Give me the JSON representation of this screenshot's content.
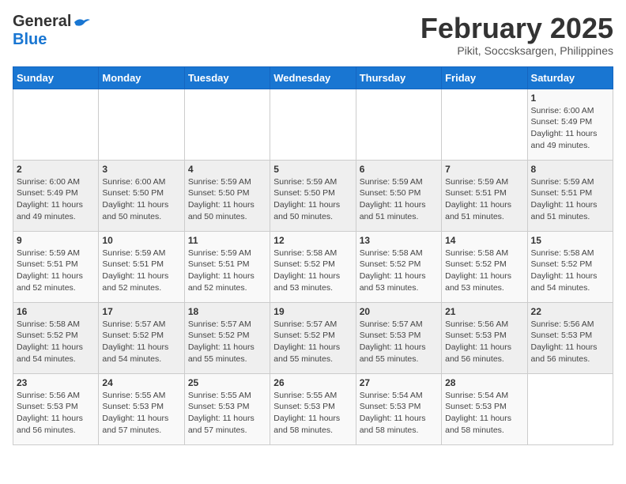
{
  "header": {
    "logo_general": "General",
    "logo_blue": "Blue",
    "month_title": "February 2025",
    "location": "Pikit, Soccsksargen, Philippines"
  },
  "calendar": {
    "days_of_week": [
      "Sunday",
      "Monday",
      "Tuesday",
      "Wednesday",
      "Thursday",
      "Friday",
      "Saturday"
    ],
    "weeks": [
      [
        {
          "day": "",
          "info": ""
        },
        {
          "day": "",
          "info": ""
        },
        {
          "day": "",
          "info": ""
        },
        {
          "day": "",
          "info": ""
        },
        {
          "day": "",
          "info": ""
        },
        {
          "day": "",
          "info": ""
        },
        {
          "day": "1",
          "info": "Sunrise: 6:00 AM\nSunset: 5:49 PM\nDaylight: 11 hours\nand 49 minutes."
        }
      ],
      [
        {
          "day": "2",
          "info": "Sunrise: 6:00 AM\nSunset: 5:49 PM\nDaylight: 11 hours\nand 49 minutes."
        },
        {
          "day": "3",
          "info": "Sunrise: 6:00 AM\nSunset: 5:50 PM\nDaylight: 11 hours\nand 50 minutes."
        },
        {
          "day": "4",
          "info": "Sunrise: 5:59 AM\nSunset: 5:50 PM\nDaylight: 11 hours\nand 50 minutes."
        },
        {
          "day": "5",
          "info": "Sunrise: 5:59 AM\nSunset: 5:50 PM\nDaylight: 11 hours\nand 50 minutes."
        },
        {
          "day": "6",
          "info": "Sunrise: 5:59 AM\nSunset: 5:50 PM\nDaylight: 11 hours\nand 51 minutes."
        },
        {
          "day": "7",
          "info": "Sunrise: 5:59 AM\nSunset: 5:51 PM\nDaylight: 11 hours\nand 51 minutes."
        },
        {
          "day": "8",
          "info": "Sunrise: 5:59 AM\nSunset: 5:51 PM\nDaylight: 11 hours\nand 51 minutes."
        }
      ],
      [
        {
          "day": "9",
          "info": "Sunrise: 5:59 AM\nSunset: 5:51 PM\nDaylight: 11 hours\nand 52 minutes."
        },
        {
          "day": "10",
          "info": "Sunrise: 5:59 AM\nSunset: 5:51 PM\nDaylight: 11 hours\nand 52 minutes."
        },
        {
          "day": "11",
          "info": "Sunrise: 5:59 AM\nSunset: 5:51 PM\nDaylight: 11 hours\nand 52 minutes."
        },
        {
          "day": "12",
          "info": "Sunrise: 5:58 AM\nSunset: 5:52 PM\nDaylight: 11 hours\nand 53 minutes."
        },
        {
          "day": "13",
          "info": "Sunrise: 5:58 AM\nSunset: 5:52 PM\nDaylight: 11 hours\nand 53 minutes."
        },
        {
          "day": "14",
          "info": "Sunrise: 5:58 AM\nSunset: 5:52 PM\nDaylight: 11 hours\nand 53 minutes."
        },
        {
          "day": "15",
          "info": "Sunrise: 5:58 AM\nSunset: 5:52 PM\nDaylight: 11 hours\nand 54 minutes."
        }
      ],
      [
        {
          "day": "16",
          "info": "Sunrise: 5:58 AM\nSunset: 5:52 PM\nDaylight: 11 hours\nand 54 minutes."
        },
        {
          "day": "17",
          "info": "Sunrise: 5:57 AM\nSunset: 5:52 PM\nDaylight: 11 hours\nand 54 minutes."
        },
        {
          "day": "18",
          "info": "Sunrise: 5:57 AM\nSunset: 5:52 PM\nDaylight: 11 hours\nand 55 minutes."
        },
        {
          "day": "19",
          "info": "Sunrise: 5:57 AM\nSunset: 5:52 PM\nDaylight: 11 hours\nand 55 minutes."
        },
        {
          "day": "20",
          "info": "Sunrise: 5:57 AM\nSunset: 5:53 PM\nDaylight: 11 hours\nand 55 minutes."
        },
        {
          "day": "21",
          "info": "Sunrise: 5:56 AM\nSunset: 5:53 PM\nDaylight: 11 hours\nand 56 minutes."
        },
        {
          "day": "22",
          "info": "Sunrise: 5:56 AM\nSunset: 5:53 PM\nDaylight: 11 hours\nand 56 minutes."
        }
      ],
      [
        {
          "day": "23",
          "info": "Sunrise: 5:56 AM\nSunset: 5:53 PM\nDaylight: 11 hours\nand 56 minutes."
        },
        {
          "day": "24",
          "info": "Sunrise: 5:55 AM\nSunset: 5:53 PM\nDaylight: 11 hours\nand 57 minutes."
        },
        {
          "day": "25",
          "info": "Sunrise: 5:55 AM\nSunset: 5:53 PM\nDaylight: 11 hours\nand 57 minutes."
        },
        {
          "day": "26",
          "info": "Sunrise: 5:55 AM\nSunset: 5:53 PM\nDaylight: 11 hours\nand 58 minutes."
        },
        {
          "day": "27",
          "info": "Sunrise: 5:54 AM\nSunset: 5:53 PM\nDaylight: 11 hours\nand 58 minutes."
        },
        {
          "day": "28",
          "info": "Sunrise: 5:54 AM\nSunset: 5:53 PM\nDaylight: 11 hours\nand 58 minutes."
        },
        {
          "day": "",
          "info": ""
        }
      ]
    ]
  }
}
